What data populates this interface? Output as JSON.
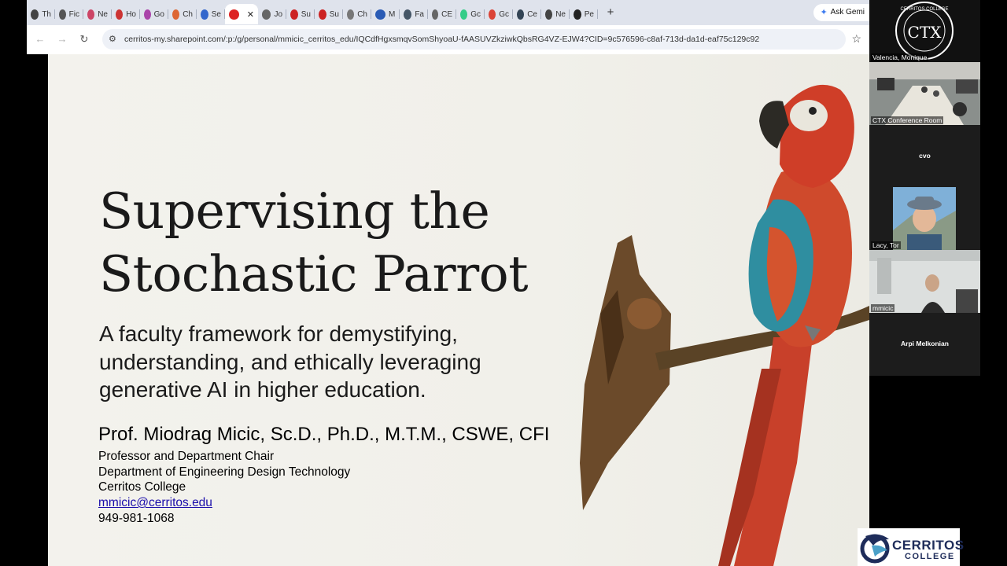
{
  "browser": {
    "tabs": [
      {
        "label": "Th",
        "color": "#444"
      },
      {
        "label": "Fic",
        "color": "#555"
      },
      {
        "label": "Ne",
        "color": "#c46"
      },
      {
        "label": "Ho",
        "color": "#c33"
      },
      {
        "label": "Go",
        "color": "#a4a"
      },
      {
        "label": "Ch",
        "color": "#d63"
      },
      {
        "label": "Se",
        "color": "#36c"
      },
      {
        "label": "",
        "color": "#d22",
        "active": true
      },
      {
        "label": "Jo",
        "color": "#666"
      },
      {
        "label": "Su",
        "color": "#c22"
      },
      {
        "label": "Su",
        "color": "#c22"
      },
      {
        "label": "Ch",
        "color": "#777"
      },
      {
        "label": "M",
        "color": "#2a5bb5"
      },
      {
        "label": "Fa",
        "color": "#456"
      },
      {
        "label": "CE",
        "color": "#666"
      },
      {
        "label": "Gc",
        "color": "#3c8"
      },
      {
        "label": "Gc",
        "color": "#db4437"
      },
      {
        "label": "Ce",
        "color": "#345"
      },
      {
        "label": "Ne",
        "color": "#444"
      },
      {
        "label": "Pe",
        "color": "#222"
      }
    ],
    "ask_gemini": "Ask Gemi",
    "url": "cerritos-my.sharepoint.com/:p:/g/personal/mmicic_cerritos_edu/IQCdfHgxsmqvSomShyoaU-fAASUVZkziwkQbsRG4VZ-EJW4?CID=9c576596-c8af-713d-da1d-eaf75c129c92"
  },
  "slide": {
    "title_line1": "Supervising the",
    "title_line2": "Stochastic Parrot",
    "subtitle": "A faculty framework for demystifying, understanding, and ethically leveraging generative AI in higher education.",
    "author": "Prof. Miodrag Micic, Sc.D., Ph.D., M.T.M., CSWE, CFI",
    "position": "Professor and Department Chair",
    "department": "Department of Engineering Design Technology",
    "college": "Cerritos College",
    "email": "mmicic@cerritos.edu",
    "phone": "949-981-1068"
  },
  "participants": [
    {
      "name": "Valencia, Monique"
    },
    {
      "name": "CTX Conference Room"
    },
    {
      "name": "cvo"
    },
    {
      "name": "Lacy, Tor"
    },
    {
      "name": "mmicic"
    },
    {
      "name": "Arpi Melkonian"
    }
  ],
  "logo": {
    "name": "CERRITOS",
    "sub": "COLLEGE",
    "badge_initials": "CTX",
    "badge_ring": "CERRITOS COLLEGE"
  }
}
